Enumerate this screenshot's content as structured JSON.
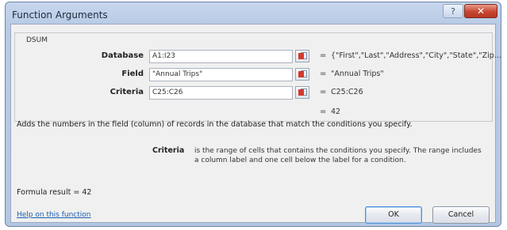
{
  "window": {
    "title": "Function Arguments",
    "help_glyph": "?",
    "close_glyph": "✕"
  },
  "function": {
    "name": "DSUM",
    "arguments": [
      {
        "label": "Database",
        "value": "A1:I23",
        "result": "{\"First\",\"Last\",\"Address\",\"City\",\"State\",\"Zip..."
      },
      {
        "label": "Field",
        "value": "\"Annual Trips\"",
        "result": "\"Annual Trips\""
      },
      {
        "label": "Criteria",
        "value": "C25:C26",
        "result": "C25:C26"
      }
    ],
    "equals_sign": "=",
    "result": "42"
  },
  "description": "Adds the numbers in the field (column) of records in the database that match the conditions you specify.",
  "argument_help": {
    "name": "Criteria",
    "text": "is the range of cells that contains the conditions you specify. The range includes a column label and one cell below the label for a condition."
  },
  "formula_result": {
    "label": "Formula result =",
    "value": "42"
  },
  "help_link": "Help on this function",
  "buttons": {
    "ok": "OK",
    "cancel": "Cancel"
  },
  "icons": {
    "collapse_dialog": "range-selector-icon"
  }
}
